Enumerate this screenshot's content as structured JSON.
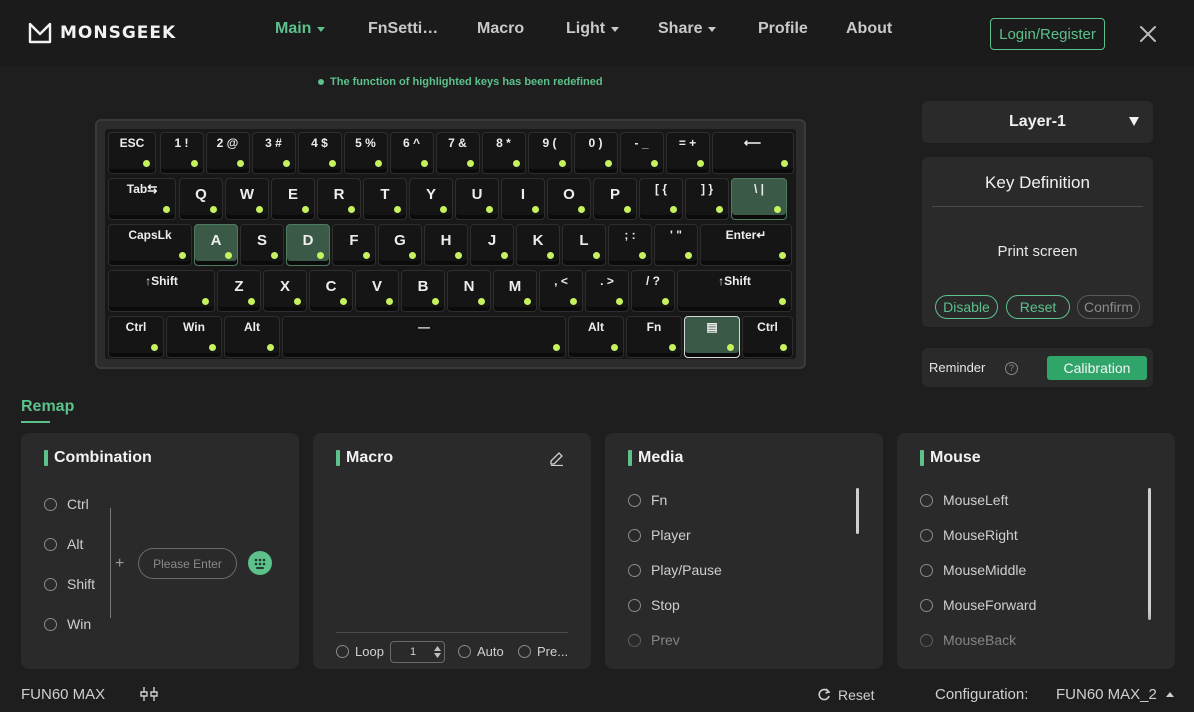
{
  "app": {
    "brand": "MONSGEEK"
  },
  "nav": {
    "items": [
      {
        "label": "Main",
        "active": true,
        "has_caret": true
      },
      {
        "label": "FnSetti…",
        "active": false,
        "has_caret": false
      },
      {
        "label": "Macro",
        "active": false,
        "has_caret": false
      },
      {
        "label": "Light",
        "active": false,
        "has_caret": true
      },
      {
        "label": "Share",
        "active": false,
        "has_caret": true
      },
      {
        "label": "Profile",
        "active": false,
        "has_caret": false
      },
      {
        "label": "About",
        "active": false,
        "has_caret": false
      }
    ],
    "login_label": "Login/Register"
  },
  "notice": "The function of highlighted keys has been redefined",
  "keyboard": {
    "rows": [
      [
        "ESC",
        "1 !",
        "2 @",
        "3 #",
        "4 $",
        "5 %",
        "6 ^",
        "7 &",
        "8 *",
        "9 (",
        "0 )",
        "- _",
        "= +",
        "⟵"
      ],
      [
        "Tab⇆",
        "Q",
        "W",
        "E",
        "R",
        "T",
        "Y",
        "U",
        "I",
        "O",
        "P",
        "[ {",
        "] }",
        "\\ |"
      ],
      [
        "CapsLk",
        "A",
        "S",
        "D",
        "F",
        "G",
        "H",
        "J",
        "K",
        "L",
        "; :",
        "' \"",
        "Enter↵"
      ],
      [
        "↑Shift",
        "Z",
        "X",
        "C",
        "V",
        "B",
        "N",
        "M",
        ", <",
        ". >",
        "/ ?",
        "↑Shift"
      ],
      [
        "Ctrl",
        "Win",
        "Alt",
        "—",
        "Alt",
        "Fn",
        "▤",
        "Ctrl"
      ]
    ],
    "highlighted": [
      "A",
      "D",
      "\\ |",
      "▤"
    ]
  },
  "layer": {
    "label": "Layer-1"
  },
  "key_definition": {
    "title": "Key Definition",
    "value": "Print screen",
    "disable_label": "Disable",
    "reset_label": "Reset",
    "confirm_label": "Confirm"
  },
  "reminder": {
    "label": "Reminder",
    "help": "?",
    "calibration_label": "Calibration"
  },
  "remap": {
    "tab_label": "Remap",
    "combination": {
      "title": "Combination",
      "modifiers": [
        "Ctrl",
        "Alt",
        "Shift",
        "Win"
      ],
      "plus": "+",
      "input_placeholder": "Please Enter"
    },
    "macro": {
      "title": "Macro",
      "loop_label": "Loop",
      "loop_value": "1",
      "auto_label": "Auto",
      "press_label": "Pre..."
    },
    "media": {
      "title": "Media",
      "items": [
        "Fn",
        "Player",
        "Play/Pause",
        "Stop",
        "Prev"
      ]
    },
    "mouse": {
      "title": "Mouse",
      "items": [
        "MouseLeft",
        "MouseRight",
        "MouseMiddle",
        "MouseForward",
        "MouseBack"
      ]
    }
  },
  "footer": {
    "device": "FUN60 MAX",
    "reset_label": "Reset",
    "config_label": "Configuration:",
    "config_value": "FUN60 MAX_2"
  },
  "colors": {
    "accent": "#5cc18b",
    "led": "#c6f25f",
    "bg": "#1e1e1e",
    "panel": "#2a2a2a"
  }
}
